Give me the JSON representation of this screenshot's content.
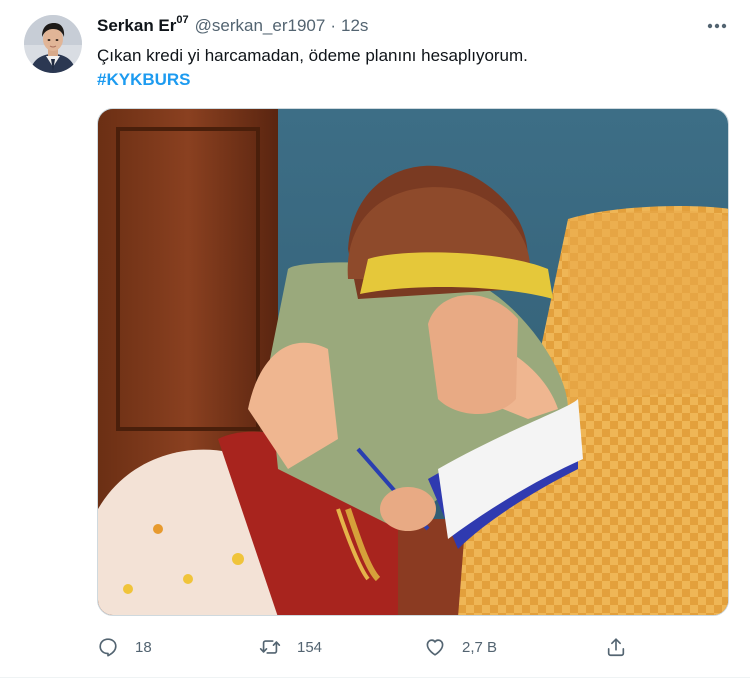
{
  "tweet": {
    "author_name": "Serkan Er",
    "author_name_sup": "07",
    "handle": "@serkan_er1907",
    "separator": "·",
    "time": "12s",
    "text": "Çıkan kredi yi harcamadan, ödeme planını hesaplıyorum.",
    "hashtag": "#KYKBURS"
  },
  "actions": {
    "reply_count": "18",
    "retweet_count": "154",
    "like_count": "2,7 B"
  },
  "colors": {
    "text": "#0f1419",
    "secondary": "#536471",
    "accent": "#1d9bf0",
    "border": "#eff3f4"
  },
  "icons": {
    "more": "more-dots-icon",
    "reply": "reply-icon",
    "retweet": "retweet-icon",
    "like": "heart-icon",
    "share": "share-icon"
  }
}
